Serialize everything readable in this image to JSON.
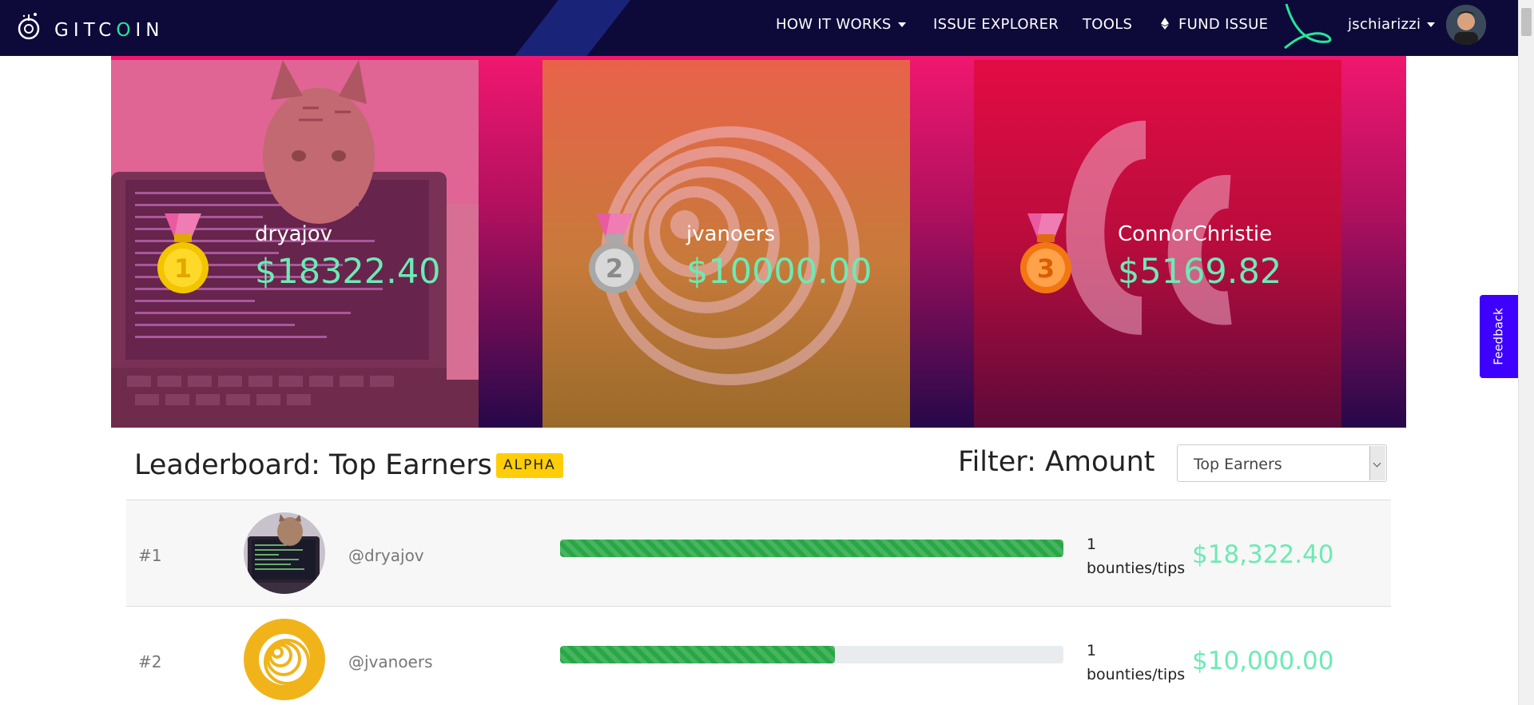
{
  "navbar": {
    "logo_prefix": "GITC",
    "logo_o": "O",
    "logo_suffix": "IN",
    "items": [
      {
        "label": "HOW IT WORKS",
        "has_caret": true
      },
      {
        "label": "ISSUE EXPLORER"
      },
      {
        "label": "TOOLS"
      },
      {
        "label": "FUND ISSUE",
        "icon": "ethereum-icon"
      }
    ],
    "username": "jschiarizzi"
  },
  "hero": {
    "cards": [
      {
        "name": "dryajov",
        "amount": "$18322.40",
        "medal": "1",
        "medal_color": "#ffd21f"
      },
      {
        "name": "jvanoers",
        "amount": "$10000.00",
        "medal": "2",
        "medal_color": "#b8b8b8"
      },
      {
        "name": "ConnorChristie",
        "amount": "$5169.82",
        "medal": "3",
        "medal_color": "#ff8a1f"
      }
    ]
  },
  "feedback_label": "Feedback",
  "leaderboard": {
    "title": "Leaderboard: Top Earners",
    "badge": "ALPHA",
    "filter_label": "Filter: Amount",
    "filter_value": "Top Earners",
    "rows": [
      {
        "rank": "#1",
        "handle": "@dryajov",
        "progress": 1.0,
        "count": "1",
        "count_label": "bounties/tips",
        "earned": "$18,322.40"
      },
      {
        "rank": "#2",
        "handle": "@jvanoers",
        "progress": 0.546,
        "count": "1",
        "count_label": "bounties/tips",
        "earned": "$10,000.00"
      }
    ]
  },
  "colors": {
    "navbar_bg": "#0d0a3a",
    "accent_green": "#6deab5",
    "badge_yellow": "#ffce08",
    "feedback_blue": "#3e00ff",
    "progress_green": "#28a745"
  }
}
